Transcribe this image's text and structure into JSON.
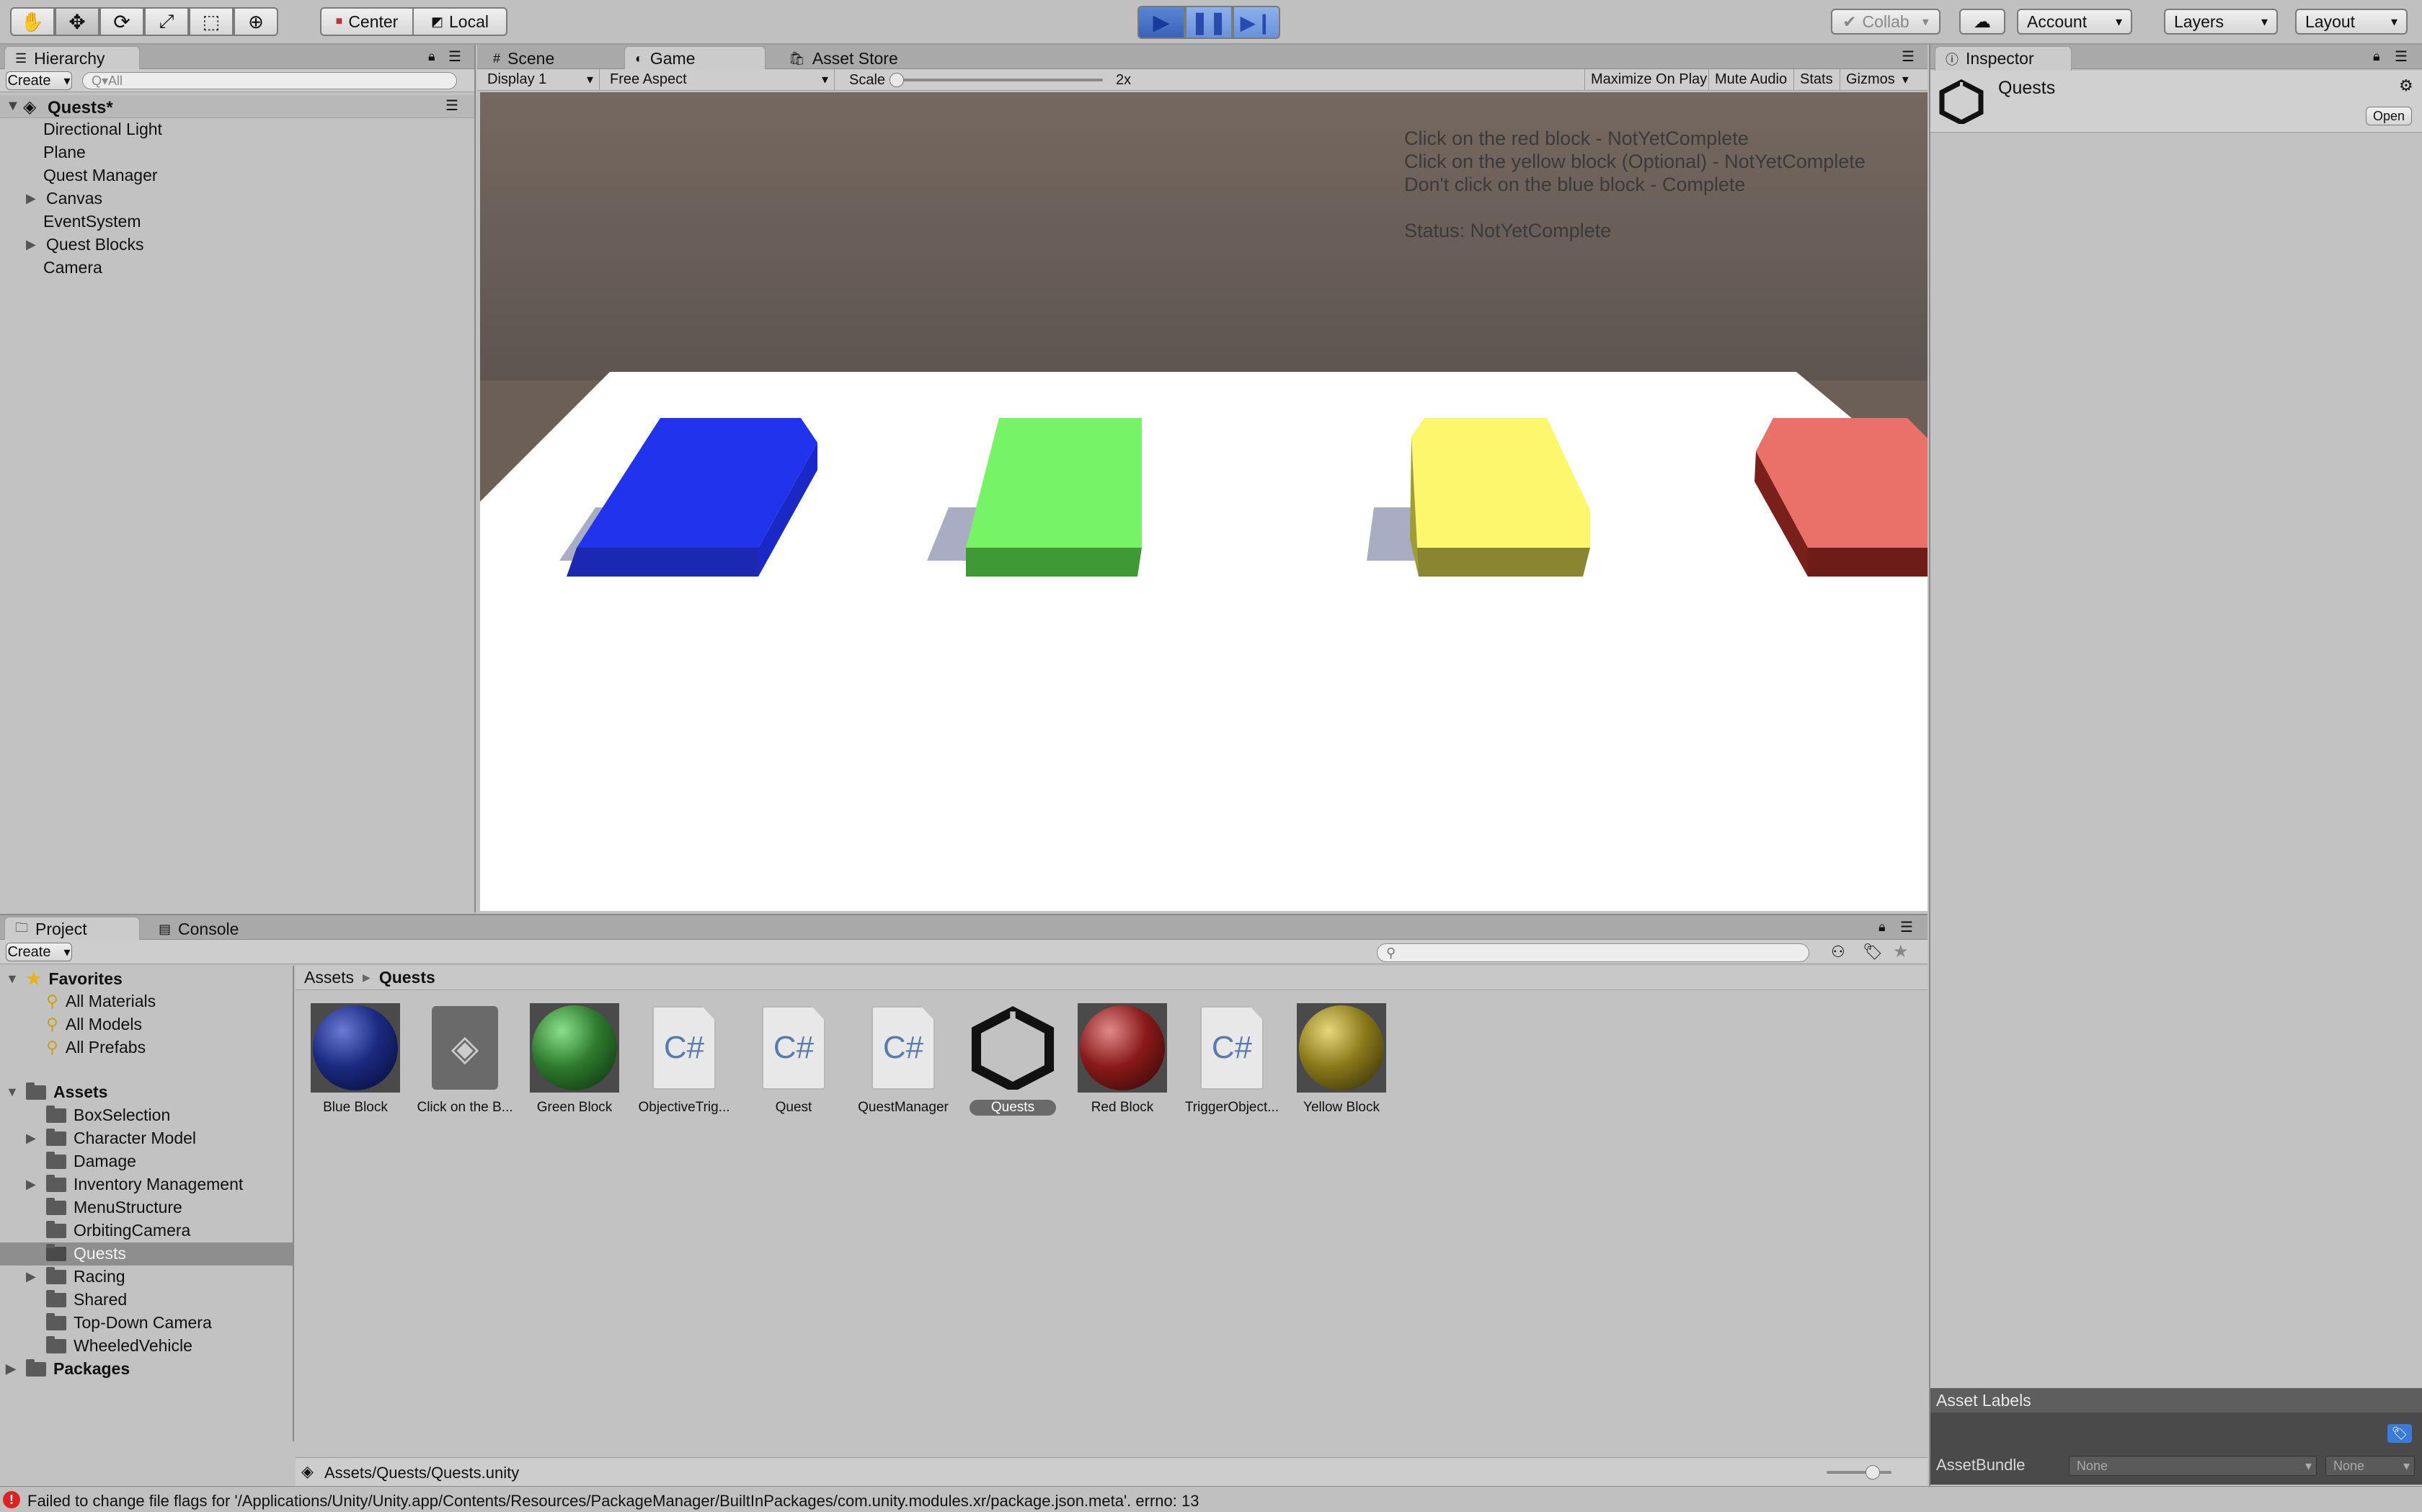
{
  "toolbar": {
    "pivot_center": "Center",
    "pivot_local": "Local",
    "collab": "Collab",
    "account": "Account",
    "layers": "Layers",
    "layout": "Layout"
  },
  "hierarchy": {
    "tab": "Hierarchy",
    "create": "Create",
    "search_placeholder": "Q▾All",
    "scene": "Quests*",
    "items": [
      "Directional Light",
      "Plane",
      "Quest Manager",
      "Canvas",
      "EventSystem",
      "Quest Blocks",
      "Camera"
    ]
  },
  "game": {
    "tabs": [
      "Scene",
      "Game",
      "Asset Store"
    ],
    "display": "Display 1",
    "aspect": "Free Aspect",
    "scale_label": "Scale",
    "scale_value": "2x",
    "toggles": [
      "Maximize On Play",
      "Mute Audio",
      "Stats",
      "Gizmos"
    ],
    "overlay_lines": [
      "Click on the red block - NotYetComplete",
      "Click on the yellow block (Optional) - NotYetComplete",
      "Don't click on the blue block - Complete",
      "Status: NotYetComplete"
    ],
    "colors": {
      "blue": "#2233ee",
      "green": "#77f466",
      "yellow": "#fdf76d",
      "red": "#ea7169"
    }
  },
  "inspector": {
    "tab": "Inspector",
    "title": "Quests",
    "open": "Open",
    "asset_labels": "Asset Labels",
    "asset_bundle": "AssetBundle",
    "bundle_value": "None",
    "variant_value": "None"
  },
  "project": {
    "tabs": [
      "Project",
      "Console"
    ],
    "create": "Create",
    "favorites": {
      "label": "Favorites",
      "items": [
        "All Materials",
        "All Models",
        "All Prefabs"
      ]
    },
    "assets": {
      "label": "Assets",
      "folders": [
        "BoxSelection",
        "Character Model",
        "Damage",
        "Inventory Management",
        "MenuStructure",
        "OrbitingCamera",
        "Quests",
        "Racing",
        "Shared",
        "Top-Down Camera",
        "WheeledVehicle"
      ]
    },
    "packages": "Packages",
    "breadcrumb": [
      "Assets",
      "Quests"
    ],
    "files": [
      {
        "name": "Blue Block",
        "kind": "material",
        "color": "#1a2a80"
      },
      {
        "name": "Click on the B...",
        "kind": "unity"
      },
      {
        "name": "Green Block",
        "kind": "material",
        "color": "#2e7a2e"
      },
      {
        "name": "ObjectiveTrig...",
        "kind": "cs"
      },
      {
        "name": "Quest",
        "kind": "cs"
      },
      {
        "name": "QuestManager",
        "kind": "cs"
      },
      {
        "name": "Quests",
        "kind": "scene"
      },
      {
        "name": "Red Block",
        "kind": "material",
        "color": "#8a1a1a"
      },
      {
        "name": "TriggerObject...",
        "kind": "cs"
      },
      {
        "name": "Yellow Block",
        "kind": "material",
        "color": "#8a7a1a"
      }
    ],
    "path": "Assets/Quests/Quests.unity"
  },
  "status": {
    "message": "Failed to change file flags for '/Applications/Unity/Unity.app/Contents/Resources/PackageManager/BuiltInPackages/com.unity.modules.xr/package.json.meta'. errno: 13"
  }
}
